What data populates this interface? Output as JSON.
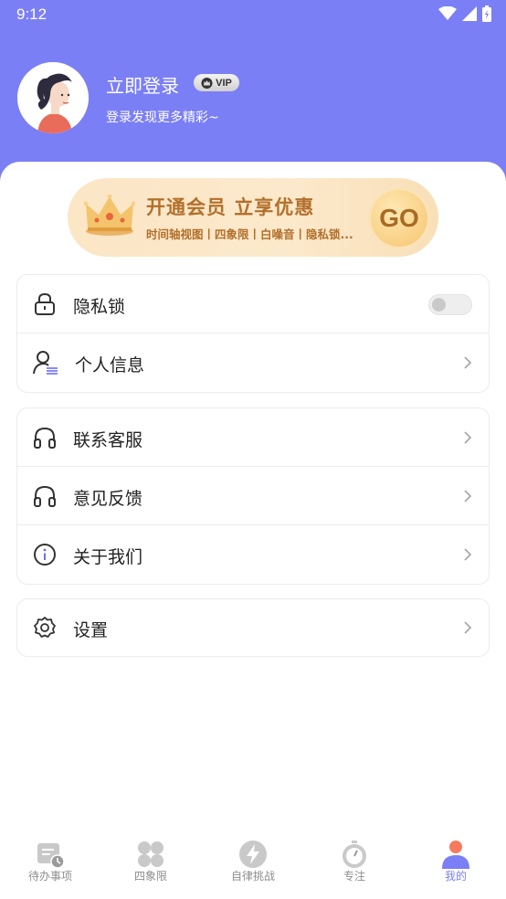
{
  "status_bar": {
    "time": "9:12"
  },
  "profile": {
    "login_title": "立即登录",
    "vip_badge": "VIP",
    "subtitle": "登录发现更多精彩~"
  },
  "vip_banner": {
    "title": "开通会员 立享优惠",
    "subtitle": "时间轴视图丨四象限丨白噪音丨隐私锁...",
    "go_label": "GO"
  },
  "card1": [
    {
      "label": "隐私锁",
      "icon": "lock-icon",
      "control": "toggle",
      "toggle_on": false
    },
    {
      "label": "个人信息",
      "icon": "user-info-icon",
      "control": "chevron"
    }
  ],
  "card2": [
    {
      "label": "联系客服",
      "icon": "headset-icon",
      "control": "chevron"
    },
    {
      "label": "意见反馈",
      "icon": "headset-icon",
      "control": "chevron"
    },
    {
      "label": "关于我们",
      "icon": "info-icon",
      "control": "chevron"
    }
  ],
  "card3": [
    {
      "label": "设置",
      "icon": "gear-icon",
      "control": "chevron"
    }
  ],
  "tabbar": [
    {
      "label": "待办事项",
      "icon": "todo-icon",
      "active": false
    },
    {
      "label": "四象限",
      "icon": "quadrant-icon",
      "active": false
    },
    {
      "label": "自律挑战",
      "icon": "lightning-icon",
      "active": false
    },
    {
      "label": "专注",
      "icon": "stopwatch-icon",
      "active": false
    },
    {
      "label": "我的",
      "icon": "profile-icon",
      "active": true
    }
  ],
  "colors": {
    "accent": "#7b7ff5",
    "banner_text": "#b2702c",
    "tab_inactive": "#8e8e8e"
  }
}
